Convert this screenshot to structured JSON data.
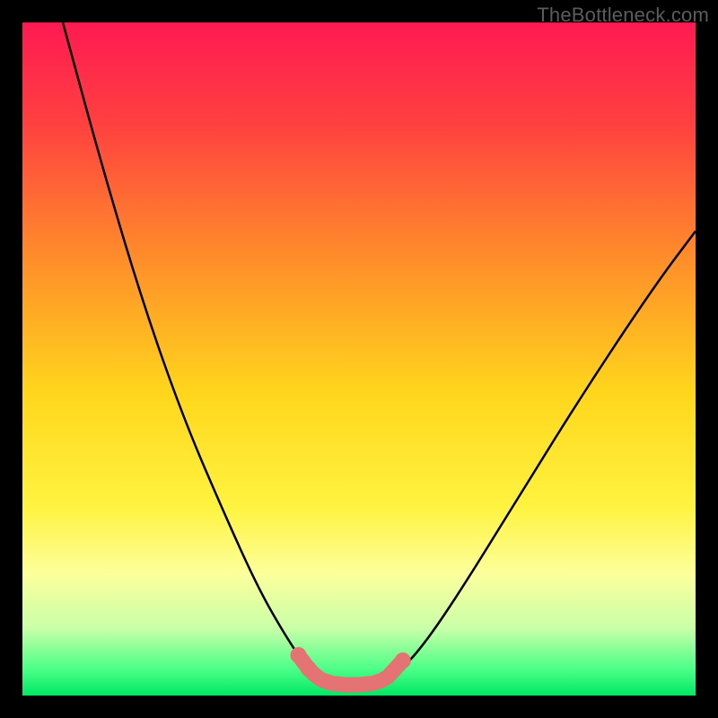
{
  "watermark": "TheBottleneck.com",
  "chart_data": {
    "type": "line",
    "title": "",
    "xlabel": "",
    "ylabel": "",
    "xlim": [
      0,
      100
    ],
    "ylim": [
      0,
      100
    ],
    "gradient_stops": [
      {
        "offset": 0.0,
        "color": "#ff1a52"
      },
      {
        "offset": 0.15,
        "color": "#ff4040"
      },
      {
        "offset": 0.35,
        "color": "#ff8d2a"
      },
      {
        "offset": 0.55,
        "color": "#ffd61c"
      },
      {
        "offset": 0.72,
        "color": "#fff340"
      },
      {
        "offset": 0.82,
        "color": "#fcff9c"
      },
      {
        "offset": 0.9,
        "color": "#c9ffa8"
      },
      {
        "offset": 0.96,
        "color": "#4dff88"
      },
      {
        "offset": 1.0,
        "color": "#00e865"
      }
    ],
    "series": [
      {
        "name": "bottleneck-curve",
        "color": "#000000",
        "points": [
          {
            "x": 6.0,
            "y": 100.0
          },
          {
            "x": 12.0,
            "y": 78.0
          },
          {
            "x": 18.0,
            "y": 58.0
          },
          {
            "x": 24.0,
            "y": 41.0
          },
          {
            "x": 30.0,
            "y": 27.0
          },
          {
            "x": 35.0,
            "y": 16.0
          },
          {
            "x": 39.0,
            "y": 9.0
          },
          {
            "x": 42.0,
            "y": 4.5
          },
          {
            "x": 44.0,
            "y": 2.5
          },
          {
            "x": 46.0,
            "y": 1.6
          },
          {
            "x": 49.0,
            "y": 1.5
          },
          {
            "x": 52.0,
            "y": 1.7
          },
          {
            "x": 54.0,
            "y": 2.2
          },
          {
            "x": 56.0,
            "y": 3.5
          },
          {
            "x": 60.0,
            "y": 8.0
          },
          {
            "x": 66.0,
            "y": 17.0
          },
          {
            "x": 74.0,
            "y": 30.0
          },
          {
            "x": 84.0,
            "y": 46.0
          },
          {
            "x": 94.0,
            "y": 61.0
          },
          {
            "x": 100.0,
            "y": 69.0
          }
        ]
      },
      {
        "name": "optimal-zone-marker",
        "color": "#e57373",
        "marker_points": [
          {
            "x": 41.0,
            "y": 6.0
          },
          {
            "x": 42.5,
            "y": 4.0
          },
          {
            "x": 43.5,
            "y": 3.0
          },
          {
            "x": 44.5,
            "y": 2.3
          },
          {
            "x": 46.0,
            "y": 1.8
          },
          {
            "x": 48.0,
            "y": 1.6
          },
          {
            "x": 50.0,
            "y": 1.6
          },
          {
            "x": 52.0,
            "y": 1.8
          },
          {
            "x": 53.3,
            "y": 2.2
          },
          {
            "x": 54.3,
            "y": 2.8
          },
          {
            "x": 56.5,
            "y": 5.2
          }
        ]
      }
    ]
  }
}
